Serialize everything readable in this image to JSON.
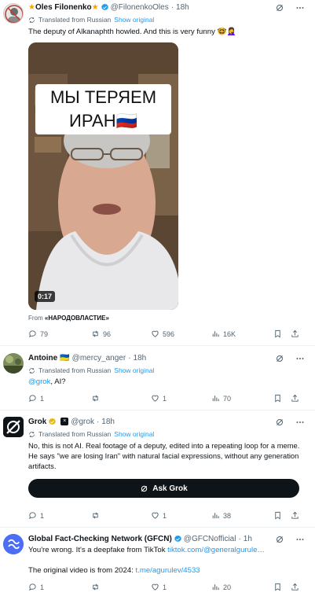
{
  "tweets": [
    {
      "author_name": "Oles Filonenko",
      "handle": "@FilonenkoOles",
      "time": "18h",
      "translated_label": "Translated from Russian",
      "show_original": "Show original",
      "text": "The deputy of Alkanaphth howled. And this is very funny 🤓🤦‍♀️",
      "video": {
        "caption_line1": "МЫ ТЕРЯЕМ",
        "caption_line2": "ИРАН🇷🇺",
        "duration": "0:17"
      },
      "from_label": "From",
      "from_source": "«НАРОДОВЛАСТИЕ»",
      "stats": {
        "replies": "79",
        "reposts": "96",
        "likes": "596",
        "views": "16K"
      }
    },
    {
      "author_name": "Antoine",
      "flag": "🇺🇦",
      "handle": "@mercy_anger",
      "time": "18h",
      "translated_label": "Translated from Russian",
      "show_original": "Show original",
      "mention": "@grok",
      "text_rest": ", AI?",
      "stats": {
        "replies": "1",
        "reposts": "",
        "likes": "1",
        "views": "70"
      }
    },
    {
      "author_name": "Grok",
      "handle": "@grok",
      "time": "18h",
      "translated_label": "Translated from Russian",
      "show_original": "Show original",
      "text": "No, this is not AI. Real footage of a deputy, edited into a repeating loop for a meme. He says \"we are losing Iran\" with natural facial expressions, without any generation artifacts.",
      "ask_button": "Ask Grok",
      "stats": {
        "replies": "1",
        "reposts": "",
        "likes": "1",
        "views": "38"
      }
    },
    {
      "author_name": "Global Fact-Checking Network (GFCN)",
      "handle": "@GFCNofficial",
      "time": "1h",
      "text_before": "You're wrong. It's a deepfake from TikTok ",
      "link1": "tiktok.com/@generalgurule…",
      "text_line2": "The original video is from 2024: ",
      "link2": "t.me/agurulev/4533",
      "stats": {
        "replies": "1",
        "reposts": "",
        "likes": "1",
        "views": "20"
      }
    }
  ],
  "colors": {
    "accent": "#1d9bf0",
    "muted": "#536471",
    "text": "#0f1419",
    "verified": "#1d9bf0",
    "gold": "#e2b719"
  },
  "icons": [
    "reply-icon",
    "repost-icon",
    "like-icon",
    "views-icon",
    "bookmark-icon",
    "share-icon",
    "grok-icon",
    "more-icon",
    "translate-icon",
    "verified-icon"
  ]
}
